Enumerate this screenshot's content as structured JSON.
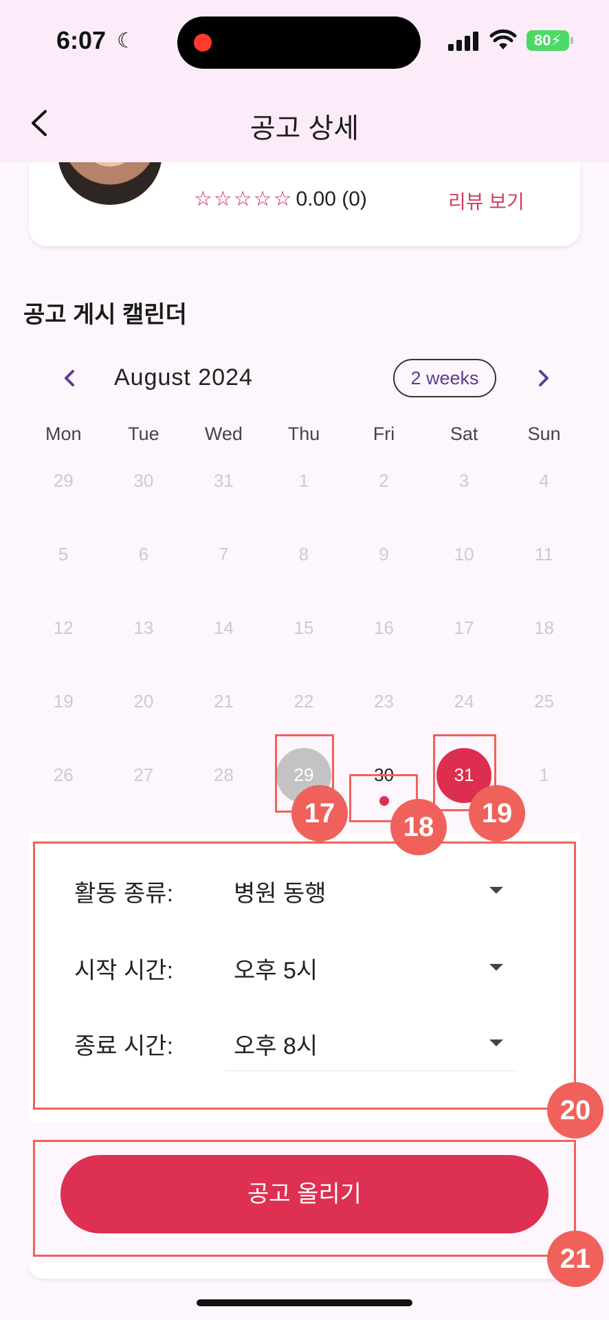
{
  "status_bar": {
    "time": "6:07",
    "battery": "80"
  },
  "header": {
    "title": "공고 상세"
  },
  "profile": {
    "stars": "☆☆☆☆☆",
    "rating_text": "0.00 (0)",
    "review_link": "리뷰 보기"
  },
  "calendar": {
    "section_title": "공고 게시 캘린더",
    "month": "August 2024",
    "format_button": "2 weeks",
    "weekdays": [
      "Mon",
      "Tue",
      "Wed",
      "Thu",
      "Fri",
      "Sat",
      "Sun"
    ],
    "weeks": [
      [
        "29",
        "30",
        "31",
        "1",
        "2",
        "3",
        "4"
      ],
      [
        "5",
        "6",
        "7",
        "8",
        "9",
        "10",
        "11"
      ],
      [
        "12",
        "13",
        "14",
        "15",
        "16",
        "17",
        "18"
      ],
      [
        "19",
        "20",
        "21",
        "22",
        "23",
        "24",
        "25"
      ],
      [
        "26",
        "27",
        "28",
        "29",
        "30",
        "31",
        "1"
      ]
    ]
  },
  "annotations": {
    "b17": "17",
    "b18": "18",
    "b19": "19",
    "b20": "20",
    "b21": "21"
  },
  "form": {
    "activity_label": "활동 종류:",
    "activity_value": "병원 동행",
    "start_label": "시작 시간:",
    "start_value": "오후 5시",
    "end_label": "종료 시간:",
    "end_value": "오후 8시"
  },
  "submit_button": "공고 올리기",
  "colors": {
    "accent": "#dd2e50",
    "annotation": "#f0615b",
    "header_bg": "#fcecf9",
    "purple": "#5a3d8f"
  }
}
